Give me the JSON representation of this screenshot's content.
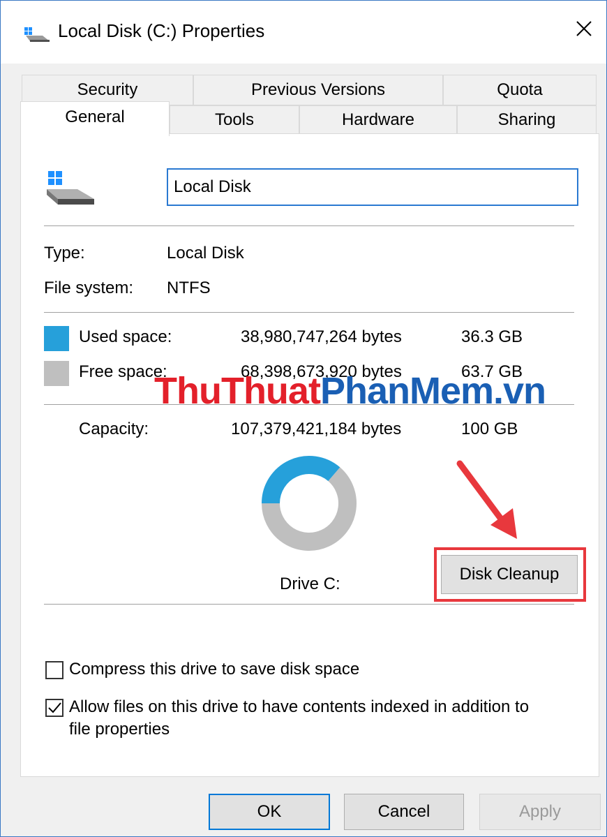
{
  "window": {
    "title": "Local Disk (C:) Properties"
  },
  "tabs": {
    "row_back": [
      "Security",
      "Previous Versions",
      "Quota"
    ],
    "row_front": [
      "General",
      "Tools",
      "Hardware",
      "Sharing"
    ],
    "active": "General"
  },
  "general": {
    "drive_name": "Local Disk",
    "type_label": "Type:",
    "type_value": "Local Disk",
    "fs_label": "File system:",
    "fs_value": "NTFS",
    "used_label": "Used space:",
    "used_bytes": "38,980,747,264 bytes",
    "used_gb": "36.3 GB",
    "free_label": "Free space:",
    "free_bytes": "68,398,673,920 bytes",
    "free_gb": "63.7 GB",
    "capacity_label": "Capacity:",
    "capacity_bytes": "107,379,421,184 bytes",
    "capacity_gb": "100 GB",
    "drive_caption": "Drive C:",
    "cleanup_button": "Disk Cleanup",
    "used_fraction": 0.363,
    "used_color": "#26a0da",
    "free_color": "#bfbfbf"
  },
  "options": {
    "compress_label": "Compress this drive to save disk space",
    "compress_checked": false,
    "index_label_line1": "Allow files on this drive to have contents indexed in addition to",
    "index_label_line2": "file properties",
    "index_checked": true
  },
  "footer": {
    "ok": "OK",
    "cancel": "Cancel",
    "apply": "Apply"
  },
  "watermark": {
    "part1": "ThuThuat",
    "part2": "PhanMem",
    "part3": ".vn"
  },
  "colors": {
    "accent": "#0078d7",
    "highlight": "#e8383d",
    "watermark_red": "#e3202a",
    "watermark_blue": "#1a5fb4"
  }
}
